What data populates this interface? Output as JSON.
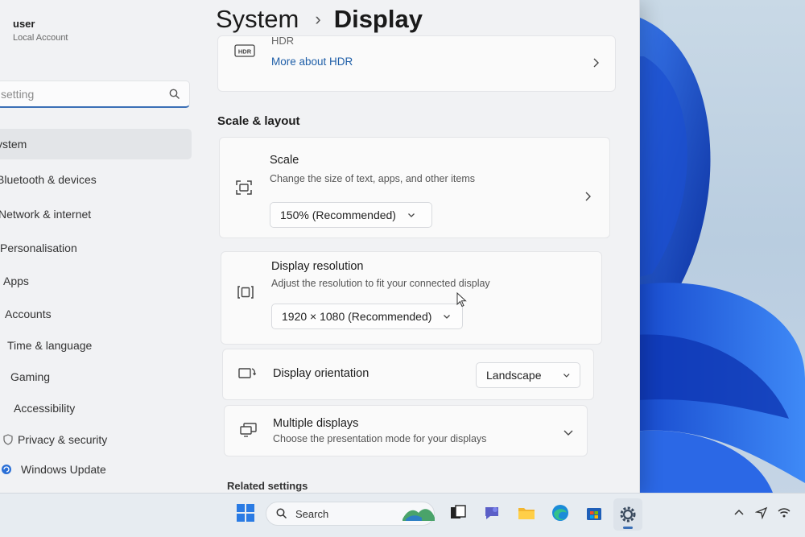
{
  "account": {
    "name": "user",
    "type": "Local Account"
  },
  "search": {
    "placeholder": "setting"
  },
  "nav": [
    {
      "label": "ystem",
      "icon": "system-icon"
    },
    {
      "label": "Bluetooth & devices",
      "icon": "bluetooth-icon"
    },
    {
      "label": "Network & internet",
      "icon": "network-icon"
    },
    {
      "label": "Personalisation",
      "icon": "brush-icon"
    },
    {
      "label": "Apps",
      "icon": "apps-icon"
    },
    {
      "label": "Accounts",
      "icon": "accounts-icon"
    },
    {
      "label": "Time & language",
      "icon": "globe-icon"
    },
    {
      "label": "Gaming",
      "icon": "gaming-icon"
    },
    {
      "label": "Accessibility",
      "icon": "accessibility-icon"
    },
    {
      "label": "Privacy & security",
      "icon": "shield-icon"
    },
    {
      "label": "Windows Update",
      "icon": "update-icon"
    }
  ],
  "breadcrumb": {
    "parent": "System",
    "separator": "›",
    "current": "Display"
  },
  "hdr": {
    "icon_text": "HDR",
    "partial_title": "HDR",
    "link": "More about HDR"
  },
  "scale_layout": {
    "heading": "Scale & layout",
    "scale": {
      "title": "Scale",
      "description": "Change the size of text, apps, and other items",
      "value": "150% (Recommended)"
    },
    "resolution": {
      "title": "Display resolution",
      "description": "Adjust the resolution to fit your connected display",
      "value": "1920 × 1080 (Recommended)"
    },
    "orientation": {
      "title": "Display orientation",
      "value": "Landscape"
    },
    "multiple": {
      "title": "Multiple displays",
      "description": "Choose the presentation mode for your displays"
    }
  },
  "related": {
    "heading": "Related settings"
  },
  "taskbar": {
    "search_label": "Search",
    "apps": [
      "start-icon",
      "widgets-icon",
      "task-view-icon",
      "chat-icon",
      "file-explorer-icon",
      "edge-icon",
      "store-icon",
      "settings-icon"
    ],
    "tray": [
      "chevron-up-icon",
      "location-icon",
      "wifi-icon"
    ]
  },
  "colors": {
    "accent": "#3b6fb6",
    "link": "#1f5fa8",
    "wallpaper_blue": "#1d55d6"
  }
}
